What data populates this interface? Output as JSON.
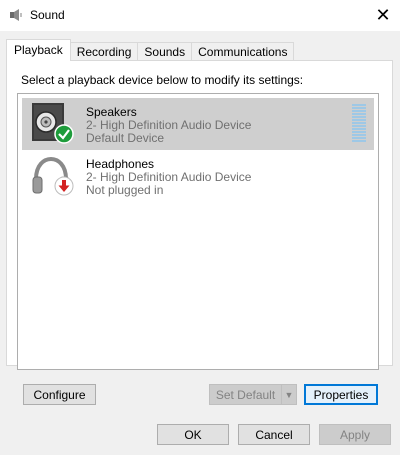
{
  "window": {
    "title": "Sound",
    "close_glyph": "✕"
  },
  "tabs": [
    {
      "label": "Playback",
      "active": true
    },
    {
      "label": "Recording",
      "active": false
    },
    {
      "label": "Sounds",
      "active": false
    },
    {
      "label": "Communications",
      "active": false
    }
  ],
  "instructions": "Select a playback device below to modify its settings:",
  "devices": [
    {
      "name": "Speakers",
      "description": "2- High Definition Audio Device",
      "status": "Default Device",
      "icon": "speaker-icon",
      "badge": "green-check-icon",
      "selected": true
    },
    {
      "name": "Headphones",
      "description": "2- High Definition Audio Device",
      "status": "Not plugged in",
      "icon": "headphones-icon",
      "badge": "red-down-arrow-icon",
      "selected": false
    }
  ],
  "buttons": {
    "configure": "Configure",
    "set_default": "Set Default",
    "properties": "Properties",
    "ok": "OK",
    "cancel": "Cancel",
    "apply": "Apply"
  },
  "colors": {
    "selection": "#cfcfcf",
    "focus": "#0078d7",
    "check": "#1e9c3b",
    "unplugged": "#d32222"
  }
}
